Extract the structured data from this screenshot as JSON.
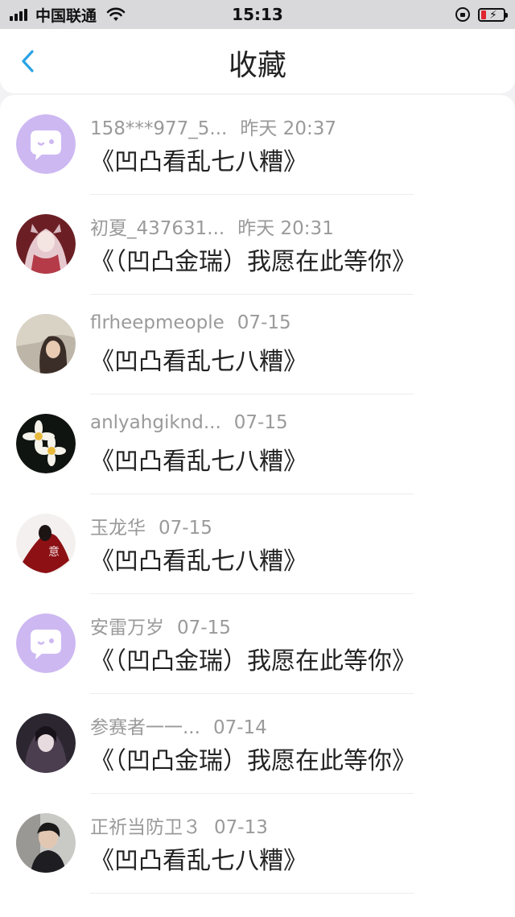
{
  "status_bar": {
    "carrier": "中国联通",
    "time": "15:13",
    "signal_bars": 4,
    "battery_level": 0.12,
    "battery_color": "#e0262f"
  },
  "header": {
    "title": "收藏",
    "back_icon": "chevron-left-icon",
    "accent": "#2aa3e6"
  },
  "items": [
    {
      "name": "158***977_5...",
      "time": "昨天 20:37",
      "message": "《凹凸看乱七八糟》",
      "avatar": "default-chat-avatar"
    },
    {
      "name": "初夏_437631...",
      "time": "昨天 20:31",
      "message": "《（凹凸金瑞）我愿在此等你》",
      "avatar": "anime-girl-avatar"
    },
    {
      "name": "flrheepmeople",
      "time": "07-15",
      "message": "《凹凸看乱七八糟》",
      "avatar": "girl-photo-avatar"
    },
    {
      "name": "anlyahgiknd...",
      "time": "07-15",
      "message": "《凹凸看乱七八糟》",
      "avatar": "daisy-avatar"
    },
    {
      "name": "玉龙华",
      "time": "07-15",
      "message": "《凹凸看乱七八糟》",
      "avatar": "red-character-avatar"
    },
    {
      "name": "安雷万岁",
      "time": "07-15",
      "message": "《（凹凸金瑞）我愿在此等你》",
      "avatar": "default-chat-avatar"
    },
    {
      "name": "参赛者一一...",
      "time": "07-14",
      "message": "《（凹凸金瑞）我愿在此等你》",
      "avatar": "dark-anime-avatar"
    },
    {
      "name": "正祈当防卫３",
      "time": "07-13",
      "message": "《凹凸看乱七八糟》",
      "avatar": "boy-photo-avatar"
    }
  ]
}
